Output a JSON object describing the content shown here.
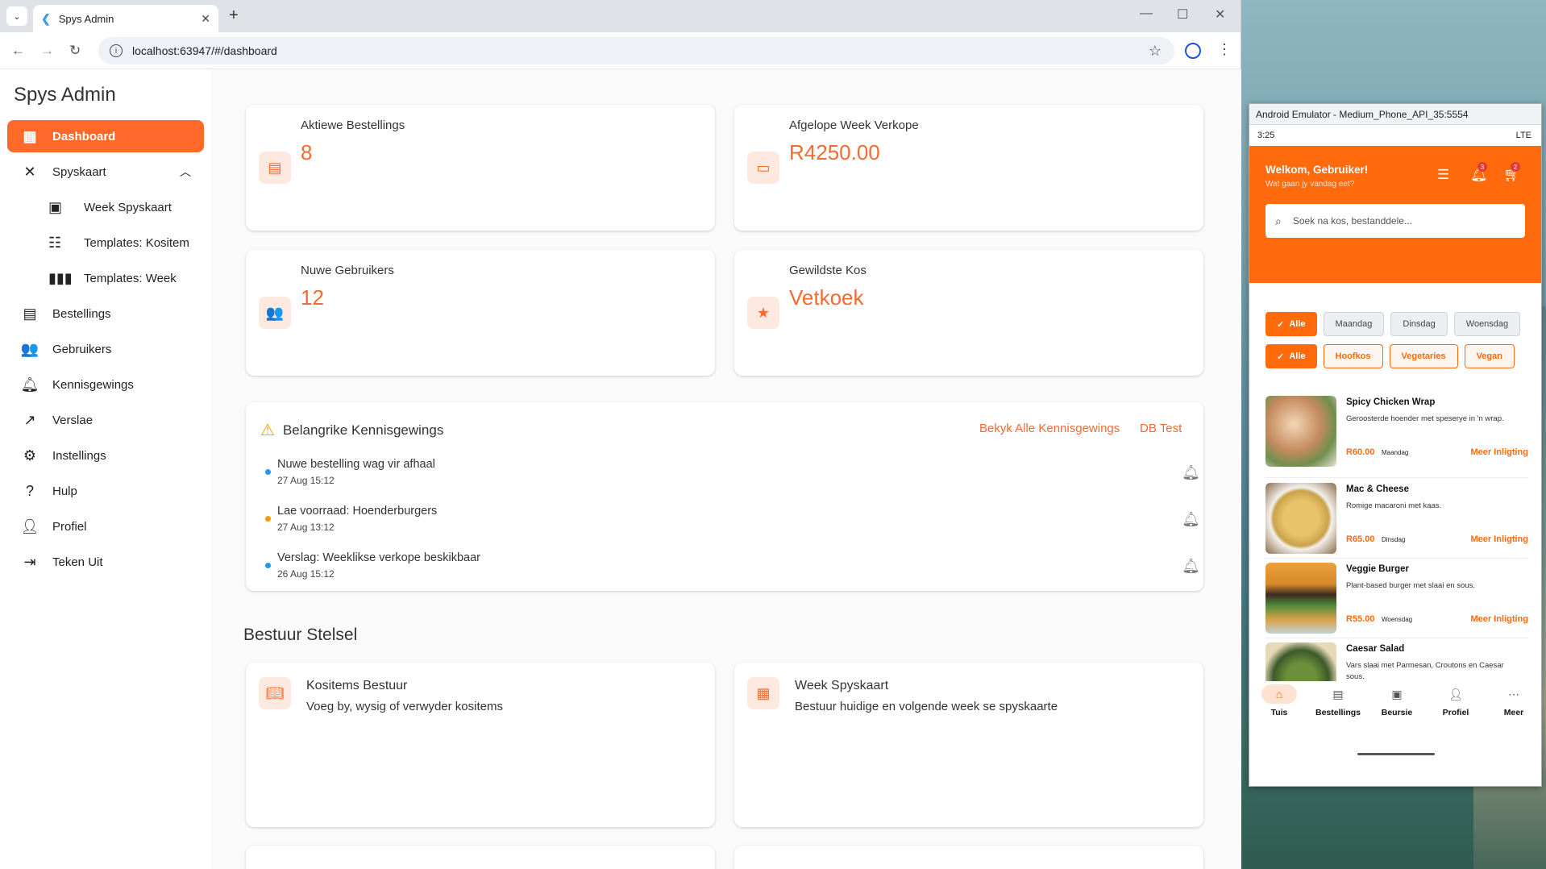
{
  "browser": {
    "tab_title": "Spys Admin",
    "url": "localhost:63947/#/dashboard"
  },
  "sidebar": {
    "brand": "Spys Admin",
    "items": [
      {
        "label": "Dashboard",
        "icon": "dashboard-icon"
      },
      {
        "label": "Spyskaart",
        "icon": "restaurant-icon"
      },
      {
        "label": "Bestellings",
        "icon": "receipt-icon"
      },
      {
        "label": "Gebruikers",
        "icon": "people-icon"
      },
      {
        "label": "Kennisgewings",
        "icon": "bell-icon"
      },
      {
        "label": "Verslae",
        "icon": "trending-icon"
      },
      {
        "label": "Instellings",
        "icon": "gear-icon"
      },
      {
        "label": "Hulp",
        "icon": "help-icon"
      },
      {
        "label": "Profiel",
        "icon": "person-icon"
      },
      {
        "label": "Teken Uit",
        "icon": "logout-icon"
      }
    ],
    "sub_items": [
      {
        "label": "Week Spyskaart",
        "icon": "calendar-icon"
      },
      {
        "label": "Templates: Kositem",
        "icon": "list-icon"
      },
      {
        "label": "Templates: Week",
        "icon": "columns-icon"
      }
    ]
  },
  "stats": [
    {
      "label": "Aktiewe Bestellings",
      "value": "8"
    },
    {
      "label": "Afgelope Week Verkope",
      "value": "R4250.00"
    },
    {
      "label": "Nuwe Gebruikers",
      "value": "12"
    },
    {
      "label": "Gewildste Kos",
      "value": "Vetkoek"
    }
  ],
  "notifications": {
    "title": "Belangrike Kennisgewings",
    "view_all": "Bekyk Alle Kennisgewings",
    "db_test": "DB Test",
    "items": [
      {
        "title": "Nuwe bestelling wag vir afhaal",
        "time": "27 Aug 15:12",
        "color": "#2196f3"
      },
      {
        "title": "Lae voorraad: Hoenderburgers",
        "time": "27 Aug 13:12",
        "color": "#ff9800"
      },
      {
        "title": "Verslag: Weeklikse verkope beskikbaar",
        "time": "26 Aug 15:12",
        "color": "#2196f3"
      }
    ]
  },
  "manage": {
    "title": "Bestuur Stelsel",
    "cards": [
      {
        "title": "Kositems Bestuur",
        "desc": "Voeg by, wysig of verwyder kositems"
      },
      {
        "title": "Week Spyskaart",
        "desc": "Bestuur huidige en volgende week se spyskaarte"
      }
    ]
  },
  "emulator": {
    "title": "Android Emulator - Medium_Phone_API_35:5554",
    "time": "3:25",
    "signal": "LTE",
    "welcome": "Welkom, Gebruiker!",
    "subtitle": "Wat gaan jy vandag eet?",
    "notif_badge": "3",
    "cart_badge": "2",
    "search_placeholder": "Soek na kos, bestanddele...",
    "day_chips": [
      "Alle",
      "Maandag",
      "Dinsdag",
      "Woensdag"
    ],
    "cat_chips": [
      "Alle",
      "Hoofkos",
      "Vegetaries",
      "Vegan"
    ],
    "foods": [
      {
        "name": "Spicy Chicken Wrap",
        "desc": "Geroosterde hoender met speserye in 'n wrap.",
        "price": "R60.00",
        "day": "Maandag",
        "more": "Meer Inligting"
      },
      {
        "name": "Mac & Cheese",
        "desc": "Romige macaroni met kaas.",
        "price": "R65.00",
        "day": "Dinsdag",
        "more": "Meer Inligting"
      },
      {
        "name": "Veggie Burger",
        "desc": "Plant-based burger met slaai en sous.",
        "price": "R55.00",
        "day": "Woensdag",
        "more": "Meer Inligting"
      },
      {
        "name": "Caesar Salad",
        "desc": "Vars slaai met Parmesan, Croutons en Caesar sous.",
        "price": "",
        "day": "",
        "more": ""
      }
    ],
    "bottom_nav": [
      "Tuis",
      "Bestellings",
      "Beursie",
      "Profiel",
      "Meer"
    ]
  },
  "colors": {
    "accent": "#ff6a2b",
    "phone_accent": "#ff6a0d"
  }
}
